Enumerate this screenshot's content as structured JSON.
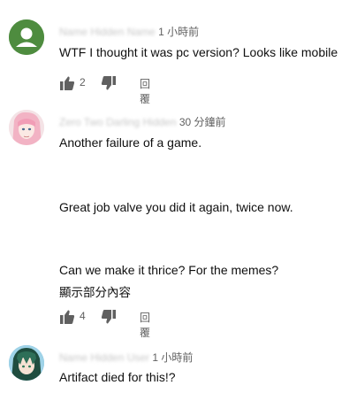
{
  "comments": [
    {
      "author": "Name Hidden Name",
      "timestamp": "1 小時前",
      "lines": [
        "WTF I thought it was pc version? Looks like mobile"
      ],
      "likes": "2",
      "reply_label": "回覆",
      "avatar_color": "#4e8c3f"
    },
    {
      "author": "Zero Two Darling Hidden",
      "timestamp": "30 分鐘前",
      "lines": [
        "Another failure of a game.",
        "Great job valve you did it again, twice now.",
        "Can we make it thrice? For the memes?"
      ],
      "read_more": "顯示部分內容",
      "likes": "4",
      "reply_label": "回覆"
    },
    {
      "author": "Name Hidden User",
      "timestamp": "1 小時前",
      "lines": [
        "Artifact died for this!?"
      ]
    }
  ]
}
